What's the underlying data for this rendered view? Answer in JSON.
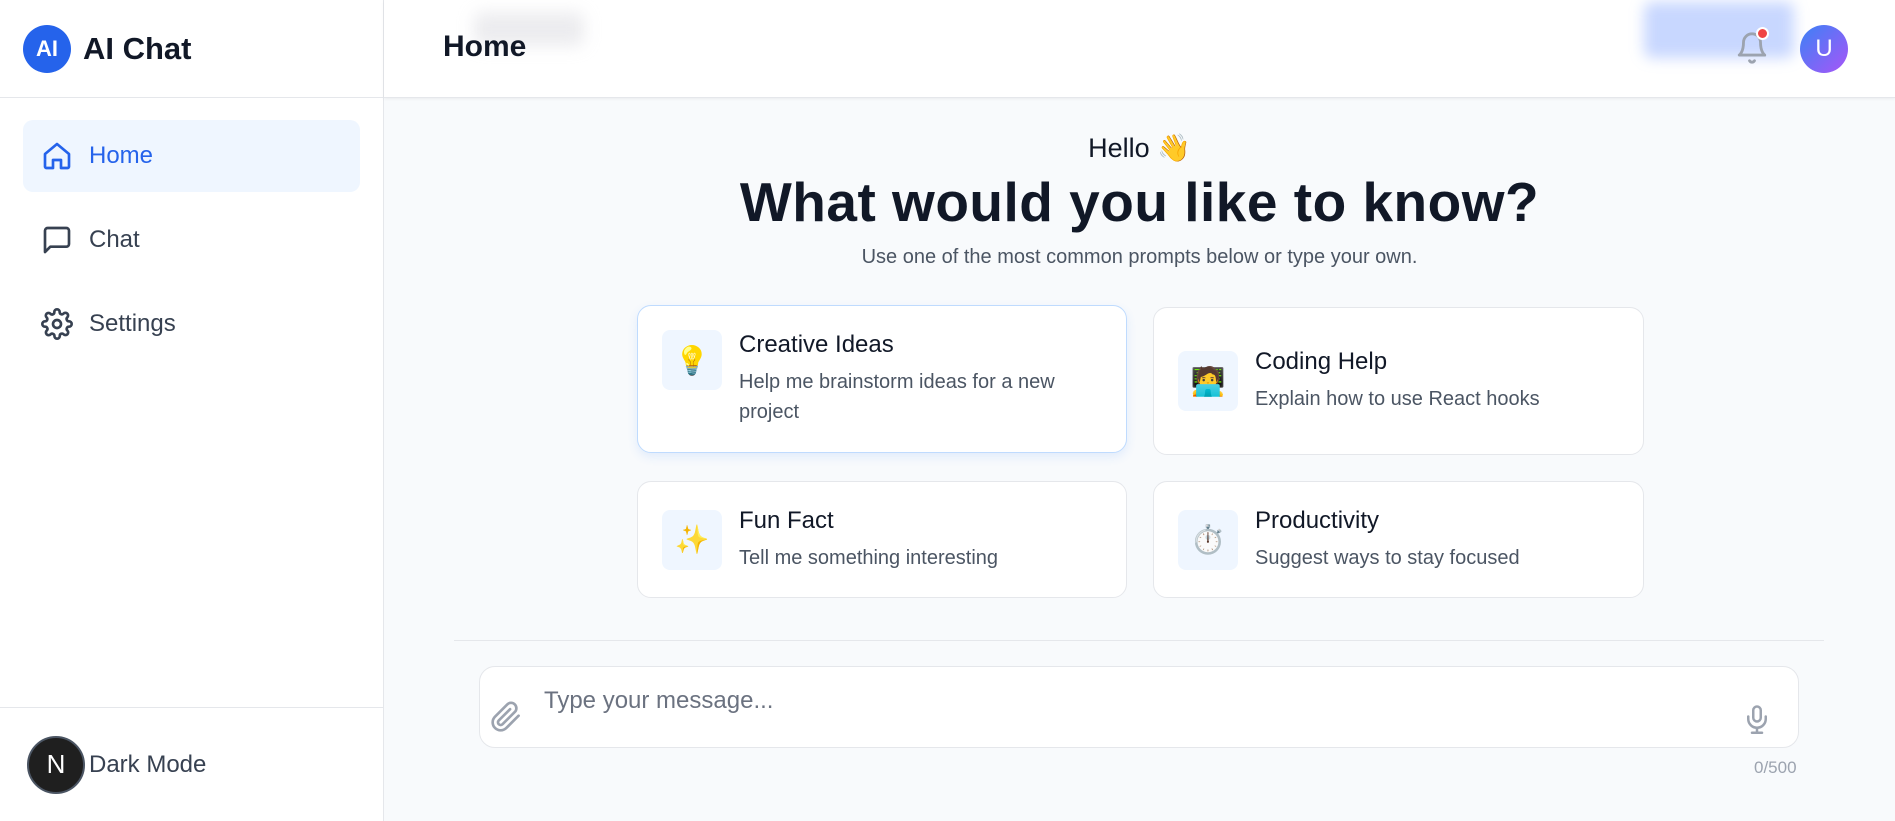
{
  "app": {
    "logo_text": "AI",
    "name": "AI Chat"
  },
  "sidebar": {
    "items": [
      {
        "label": "Home",
        "icon": "home-icon",
        "active": true
      },
      {
        "label": "Chat",
        "icon": "chat-bubble-icon",
        "active": false
      },
      {
        "label": "Settings",
        "icon": "gear-icon",
        "active": false
      }
    ],
    "dark_mode_badge": "N",
    "dark_mode_label": "Dark Mode"
  },
  "header": {
    "title": "Home",
    "notification_icon": "bell-icon",
    "has_unread": true,
    "avatar_initial": "U"
  },
  "main": {
    "greeting": "Hello 👋",
    "headline": "What would you like to know?",
    "subline": "Use one of the most common prompts below or type your own.",
    "prompts": [
      {
        "icon": "💡",
        "title": "Creative Ideas",
        "description": "Help me brainstorm ideas for a new project"
      },
      {
        "icon": "🧑‍💻",
        "title": "Coding Help",
        "description": "Explain how to use React hooks"
      },
      {
        "icon": "✨",
        "title": "Fun Fact",
        "description": "Tell me something interesting"
      },
      {
        "icon": "⏱️",
        "title": "Productivity",
        "description": "Suggest ways to stay focused"
      }
    ]
  },
  "composer": {
    "placeholder": "Type your message...",
    "value": "",
    "char_count": "0/500",
    "attach_icon": "paperclip-icon",
    "mic_icon": "microphone-icon"
  },
  "colors": {
    "accent": "#2563eb",
    "active_bg": "#eff6ff",
    "notification_dot": "#ef4444",
    "avatar_gradient_start": "#3b82f6",
    "avatar_gradient_end": "#a855f7"
  }
}
